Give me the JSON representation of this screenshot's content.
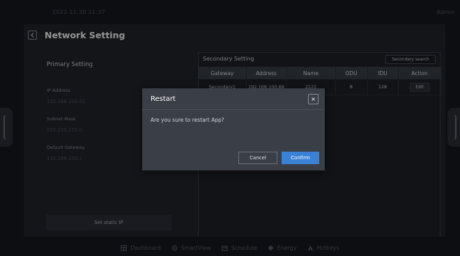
{
  "status": {
    "datetime": "2022.11.30  11:37",
    "user": "Admin"
  },
  "page": {
    "title": "Network Setting"
  },
  "primary": {
    "title": "Primary Setting",
    "fields": [
      {
        "label": "IP Address",
        "value": "192.168.100.61"
      },
      {
        "label": "Subnet Mask",
        "value": "255.255.255.0"
      },
      {
        "label": "Default Gateway",
        "value": "192.168.100.1"
      }
    ],
    "static_button": "Set static IP"
  },
  "secondary": {
    "title": "Secondary Setting",
    "search_button": "Secondary search",
    "columns": [
      "Gateway",
      "Address",
      "Name",
      "ODU",
      "IDU",
      "Action"
    ],
    "rows": [
      {
        "gateway": "Secondary1",
        "address": "192.168.100.68",
        "name": "2222",
        "odu": "8",
        "idu": "128",
        "action": "Edit"
      }
    ]
  },
  "dialog": {
    "title": "Restart",
    "message": "Are you sure to restart App?",
    "cancel": "Cancel",
    "confirm": "Confirm"
  },
  "nav": [
    {
      "label": "Dashboard",
      "icon": "dashboard-icon"
    },
    {
      "label": "SmartView",
      "icon": "smartview-icon"
    },
    {
      "label": "Schedule",
      "icon": "schedule-icon"
    },
    {
      "label": "Energy",
      "icon": "energy-icon"
    },
    {
      "label": "Hotkeys",
      "icon": "hotkeys-icon"
    }
  ],
  "colors": {
    "accent": "#3b82d6",
    "background": "#17191e",
    "panel": "#22252b",
    "dialog": "#3a3e46"
  }
}
